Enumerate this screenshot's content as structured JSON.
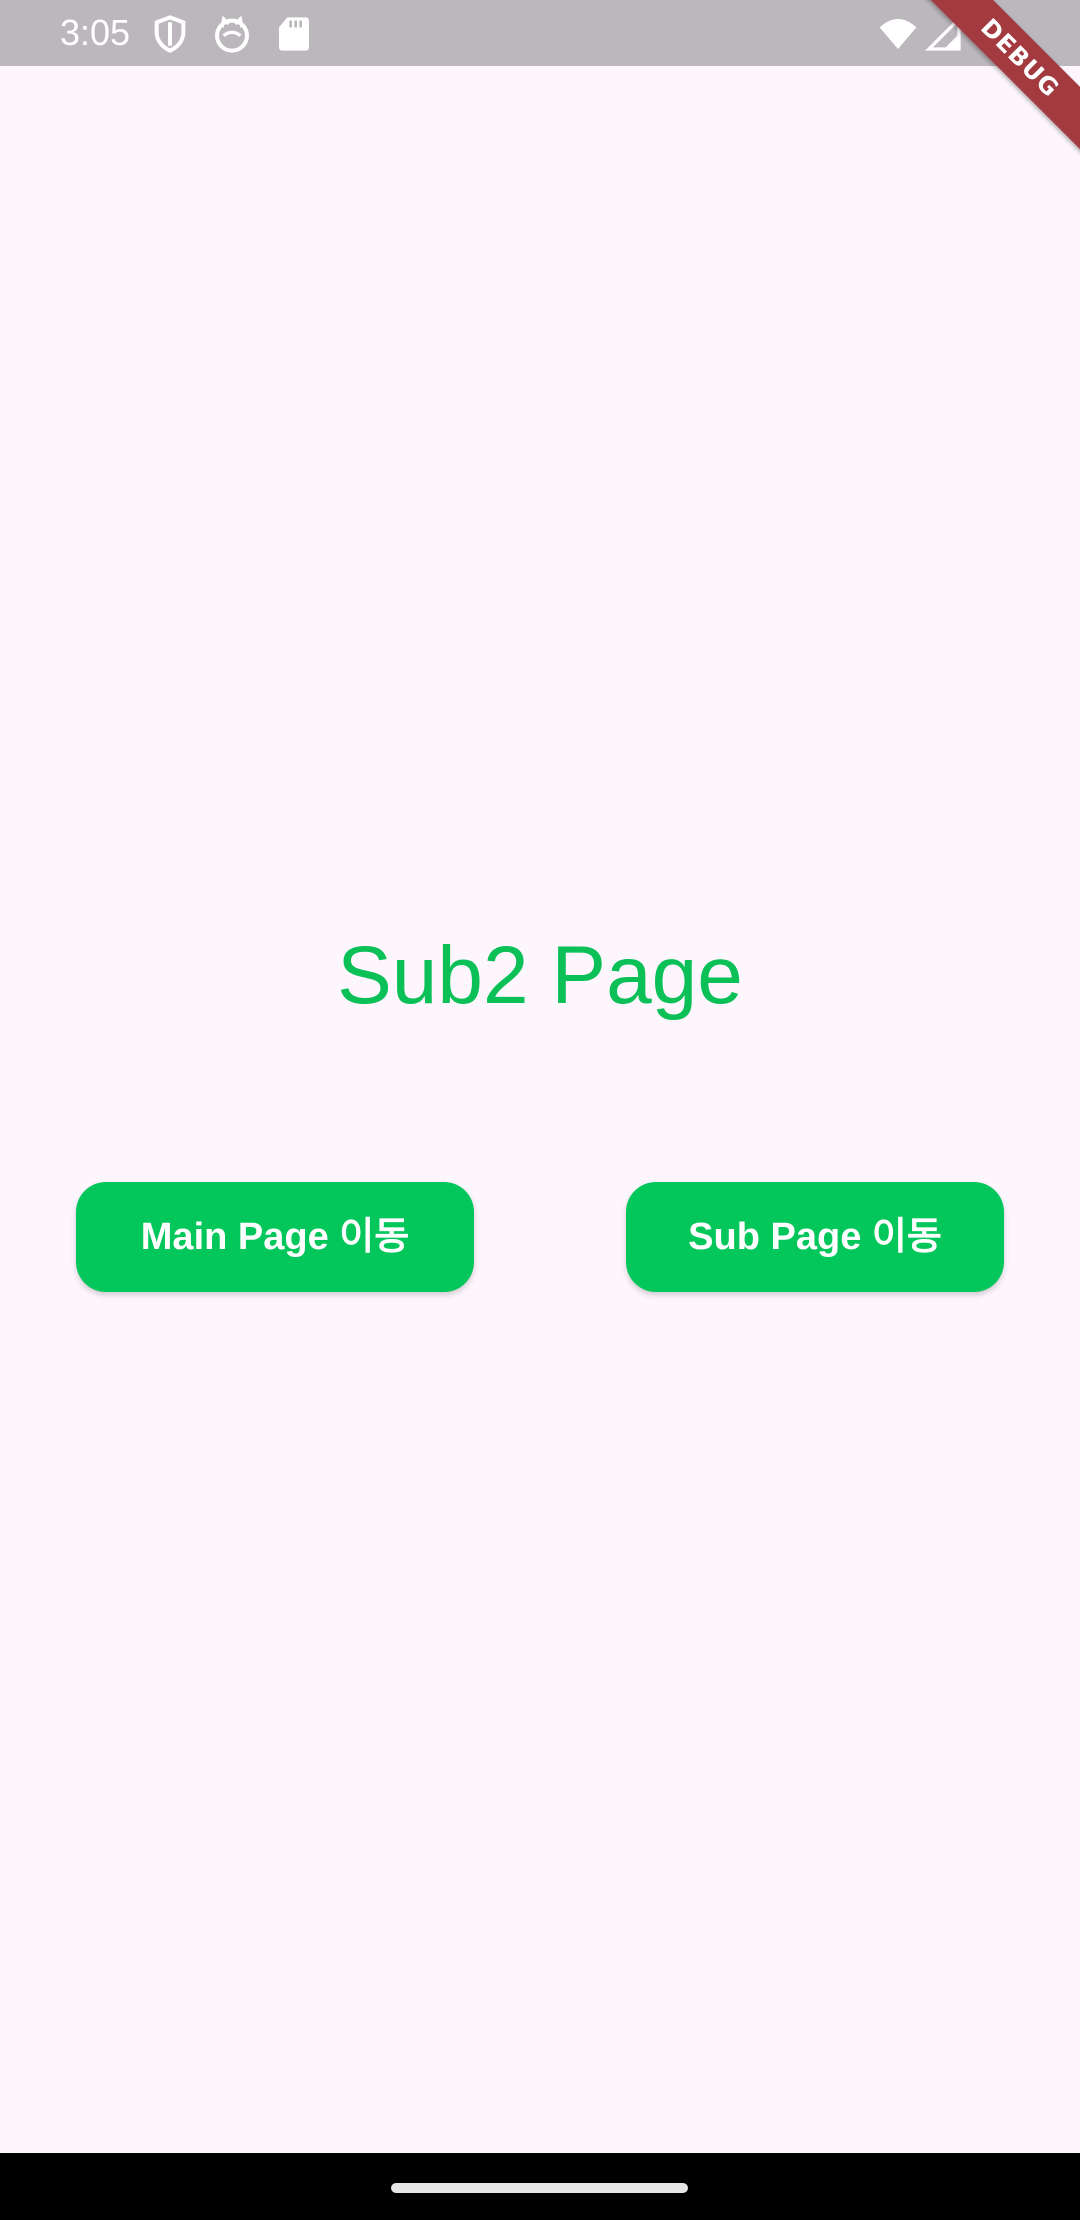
{
  "status_bar": {
    "time": "3:05",
    "icons": [
      "shield-icon",
      "cat-icon",
      "sd-card-icon",
      "wifi-icon",
      "signal-icon"
    ]
  },
  "debug_banner": {
    "label": "DEBUG"
  },
  "main": {
    "title": "Sub2 Page",
    "buttons": {
      "main_page_label": "Main Page 이동",
      "sub_page_label": "Sub Page 이동"
    }
  },
  "colors": {
    "accent": "#03c75a",
    "title": "#0ac057",
    "background": "#fdf6fd",
    "status_bar": "#bcb7bd",
    "debug_ribbon": "#a33a40"
  }
}
